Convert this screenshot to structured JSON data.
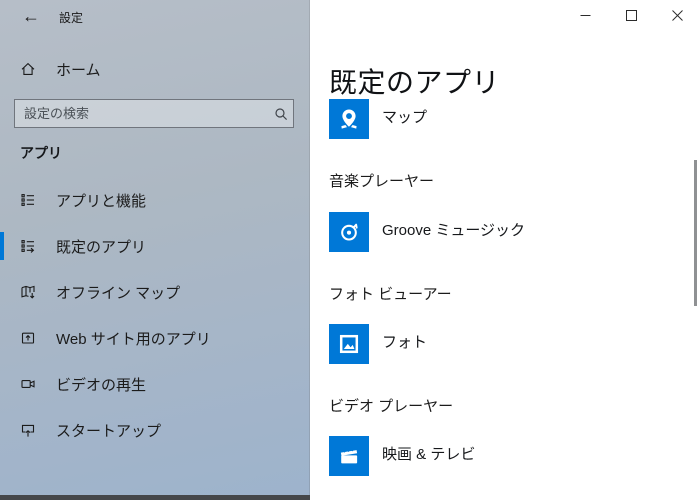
{
  "titlebar": {
    "back_glyph": "←",
    "title": "設定"
  },
  "sidebar": {
    "home_label": "ホーム",
    "search_placeholder": "設定の検索",
    "section_header": "アプリ",
    "items": [
      {
        "label": "アプリと機能",
        "selected": false
      },
      {
        "label": "既定のアプリ",
        "selected": true
      },
      {
        "label": "オフライン マップ",
        "selected": false
      },
      {
        "label": "Web サイト用のアプリ",
        "selected": false
      },
      {
        "label": "ビデオの再生",
        "selected": false
      },
      {
        "label": "スタートアップ",
        "selected": false
      }
    ]
  },
  "main": {
    "title": "既定のアプリ",
    "sections": [
      {
        "category": "",
        "app_name": "マップ",
        "icon": "maps-app-icon"
      },
      {
        "category": "音楽プレーヤー",
        "app_name": "Groove ミュージック",
        "icon": "groove-music-app-icon"
      },
      {
        "category": "フォト ビューアー",
        "app_name": "フォト",
        "icon": "photos-app-icon"
      },
      {
        "category": "ビデオ プレーヤー",
        "app_name": "映画 & テレビ",
        "icon": "movies-tv-app-icon"
      }
    ]
  },
  "window_controls": {
    "minimize": "minimize",
    "maximize": "maximize",
    "close": "close"
  },
  "colors": {
    "accent_blue": "#0078d7",
    "app_tile_blue": "#0078d7",
    "sidebar_top": "#b6bec8",
    "sidebar_bottom": "#9db3cc",
    "content_background": "#ffffff"
  }
}
